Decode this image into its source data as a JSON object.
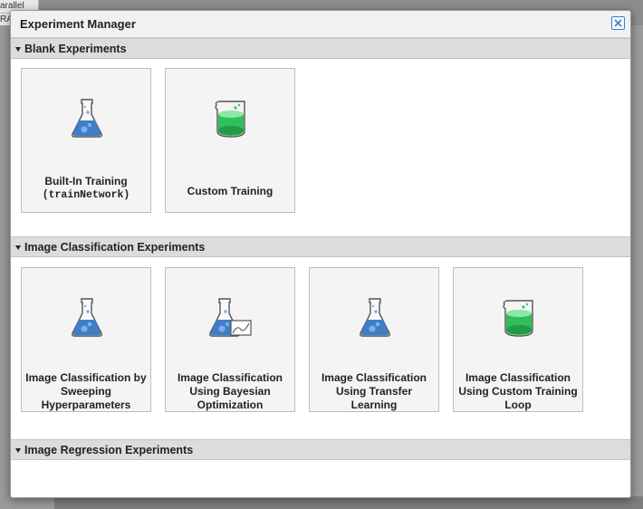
{
  "background": {
    "tab_text_line1": "arallel",
    "tab_text_line2": "RA"
  },
  "dialog": {
    "title": "Experiment Manager",
    "close_icon": "close-icon"
  },
  "sections": [
    {
      "label": "Blank Experiments",
      "tiles": [
        {
          "line1": "Built-In Training",
          "line2": "(trainNetwork)",
          "icon": "flask-icon"
        },
        {
          "line1": "Custom Training",
          "icon": "beaker-icon"
        }
      ]
    },
    {
      "label": "Image Classification Experiments",
      "tiles": [
        {
          "line1": "Image Classification by",
          "line2": "Sweeping",
          "line3": "Hyperparameters",
          "icon": "flask-icon"
        },
        {
          "line1": "Image Classification",
          "line2": "Using Bayesian",
          "line3": "Optimization",
          "icon": "flask-chart-icon"
        },
        {
          "line1": "Image Classification",
          "line2": "Using Transfer",
          "line3": "Learning",
          "icon": "flask-icon"
        },
        {
          "line1": "Image Classification",
          "line2": "Using Custom Training",
          "line3": "Loop",
          "icon": "beaker-icon"
        }
      ]
    },
    {
      "label": "Image Regression Experiments",
      "tiles": []
    }
  ],
  "colors": {
    "flask_blue": "#3f7fc8",
    "beaker_green": "#2fbf5b",
    "close_border": "#3b7fd1"
  }
}
